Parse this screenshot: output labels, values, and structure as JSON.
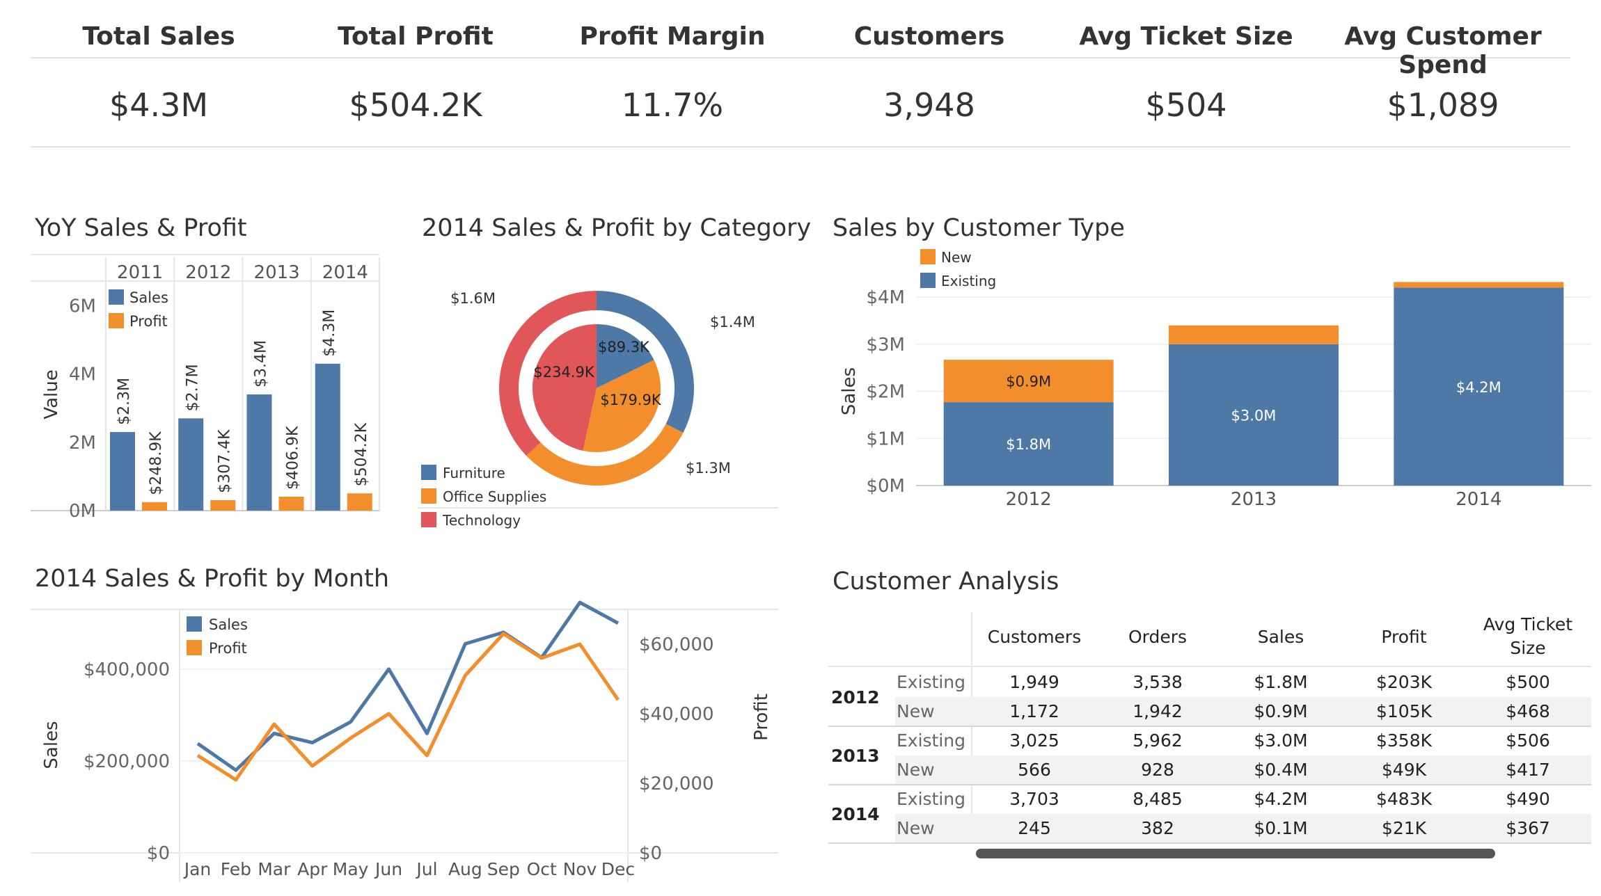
{
  "kpis": [
    {
      "label": "Total Sales",
      "value": "$4.3M"
    },
    {
      "label": "Total Profit",
      "value": "$504.2K"
    },
    {
      "label": "Profit Margin",
      "value": "11.7%"
    },
    {
      "label": "Customers",
      "value": "3,948"
    },
    {
      "label": "Avg Ticket Size",
      "value": "$504"
    },
    {
      "label": "Avg Customer Spend",
      "value": "$1,089"
    }
  ],
  "colors": {
    "sales": "#4e79a7",
    "profit": "#f28e2b",
    "technology": "#e15759",
    "grid": "#e6e6e6",
    "axis": "#777777"
  },
  "chart_data": [
    {
      "type": "bar",
      "title": "YoY Sales & Profit",
      "ylabel": "Value",
      "categories": [
        "2011",
        "2012",
        "2013",
        "2014"
      ],
      "ylim": [
        0,
        6800000
      ],
      "yticks": [
        {
          "value": 0,
          "label": "0M"
        },
        {
          "value": 2000000,
          "label": "2M"
        },
        {
          "value": 4000000,
          "label": "4M"
        },
        {
          "value": 6000000,
          "label": "6M"
        }
      ],
      "legend": {
        "position": "top-left",
        "items": [
          "Sales",
          "Profit"
        ]
      },
      "series": [
        {
          "name": "Sales",
          "values": [
            2300000,
            2700000,
            3400000,
            4300000
          ],
          "labels": [
            "$2.3M",
            "$2.7M",
            "$3.4M",
            "$4.3M"
          ]
        },
        {
          "name": "Profit",
          "values": [
            248900,
            307400,
            406900,
            504200
          ],
          "labels": [
            "$248.9K",
            "$307.4K",
            "$406.9K",
            "$504.2K"
          ]
        }
      ]
    },
    {
      "type": "pie",
      "title": "2014 Sales & Profit by Category",
      "legend": {
        "position": "bottom-left",
        "items": [
          "Furniture",
          "Office Supplies",
          "Technology"
        ]
      },
      "outer_ring": {
        "measure": "Sales",
        "slices": [
          {
            "name": "Furniture",
            "value": 1.4,
            "label": "$1.4M"
          },
          {
            "name": "Office Supplies",
            "value": 1.3,
            "label": "$1.3M"
          },
          {
            "name": "Technology",
            "value": 1.6,
            "label": "$1.6M"
          }
        ]
      },
      "inner_pie": {
        "measure": "Profit",
        "slices": [
          {
            "name": "Furniture",
            "value": 89.3,
            "label": "$89.3K"
          },
          {
            "name": "Office Supplies",
            "value": 179.9,
            "label": "$179.9K"
          },
          {
            "name": "Technology",
            "value": 234.9,
            "label": "$234.9K"
          }
        ]
      }
    },
    {
      "type": "bar",
      "stacked": true,
      "title": "Sales by Customer Type",
      "ylabel": "Sales",
      "categories": [
        "2012",
        "2013",
        "2014"
      ],
      "ylim": [
        0,
        4.4
      ],
      "yticks": [
        {
          "value": 0,
          "label": "$0M"
        },
        {
          "value": 1,
          "label": "$1M"
        },
        {
          "value": 2,
          "label": "$2M"
        },
        {
          "value": 3,
          "label": "$3M"
        },
        {
          "value": 4,
          "label": "$4M"
        }
      ],
      "legend": {
        "position": "top-left",
        "items": [
          "New",
          "Existing"
        ]
      },
      "series": [
        {
          "name": "Existing",
          "values": [
            1.77,
            3.0,
            4.2
          ],
          "labels": [
            "$1.8M",
            "$3.0M",
            "$4.2M"
          ]
        },
        {
          "name": "New",
          "values": [
            0.9,
            0.4,
            0.12
          ],
          "labels": [
            "$0.9M",
            "",
            ""
          ]
        }
      ]
    },
    {
      "type": "line",
      "title": "2014 Sales & Profit by Month",
      "ylabel": "Sales",
      "y2label": "Profit",
      "categories": [
        "Jan",
        "Feb",
        "Mar",
        "Apr",
        "May",
        "Jun",
        "Jul",
        "Aug",
        "Sep",
        "Oct",
        "Nov",
        "Dec"
      ],
      "ylim": [
        0,
        530000
      ],
      "yticks": [
        {
          "value": 0,
          "label": "$0"
        },
        {
          "value": 200000,
          "label": "$200,000"
        },
        {
          "value": 400000,
          "label": "$400,000"
        }
      ],
      "y2lim": [
        0,
        70000
      ],
      "y2ticks": [
        {
          "value": 0,
          "label": "$0"
        },
        {
          "value": 20000,
          "label": "$20,000"
        },
        {
          "value": 40000,
          "label": "$40,000"
        },
        {
          "value": 60000,
          "label": "$60,000"
        }
      ],
      "legend": {
        "position": "top-left",
        "items": [
          "Sales",
          "Profit"
        ]
      },
      "series": [
        {
          "name": "Sales",
          "axis": "left",
          "values": [
            238000,
            180000,
            260000,
            240000,
            285000,
            400000,
            260000,
            455000,
            480000,
            425000,
            545000,
            500000
          ]
        },
        {
          "name": "Profit",
          "axis": "right",
          "values": [
            28000,
            21000,
            37000,
            25000,
            33000,
            40000,
            28000,
            51000,
            63000,
            56000,
            60000,
            44000
          ]
        }
      ]
    },
    {
      "type": "table",
      "title": "Customer Analysis",
      "columns": [
        "Customers",
        "Orders",
        "Sales",
        "Profit",
        "Avg Ticket Size"
      ],
      "groups": [
        {
          "year": "2012",
          "rows": [
            {
              "type": "Existing",
              "cells": [
                "1,949",
                "3,538",
                "$1.8M",
                "$203K",
                "$500"
              ]
            },
            {
              "type": "New",
              "cells": [
                "1,172",
                "1,942",
                "$0.9M",
                "$105K",
                "$468"
              ]
            }
          ]
        },
        {
          "year": "2013",
          "rows": [
            {
              "type": "Existing",
              "cells": [
                "3,025",
                "5,962",
                "$3.0M",
                "$358K",
                "$506"
              ]
            },
            {
              "type": "New",
              "cells": [
                "566",
                "928",
                "$0.4M",
                "$49K",
                "$417"
              ]
            }
          ]
        },
        {
          "year": "2014",
          "rows": [
            {
              "type": "Existing",
              "cells": [
                "3,703",
                "8,485",
                "$4.2M",
                "$483K",
                "$490"
              ]
            },
            {
              "type": "New",
              "cells": [
                "245",
                "382",
                "$0.1M",
                "$21K",
                "$367"
              ]
            }
          ]
        }
      ]
    }
  ]
}
